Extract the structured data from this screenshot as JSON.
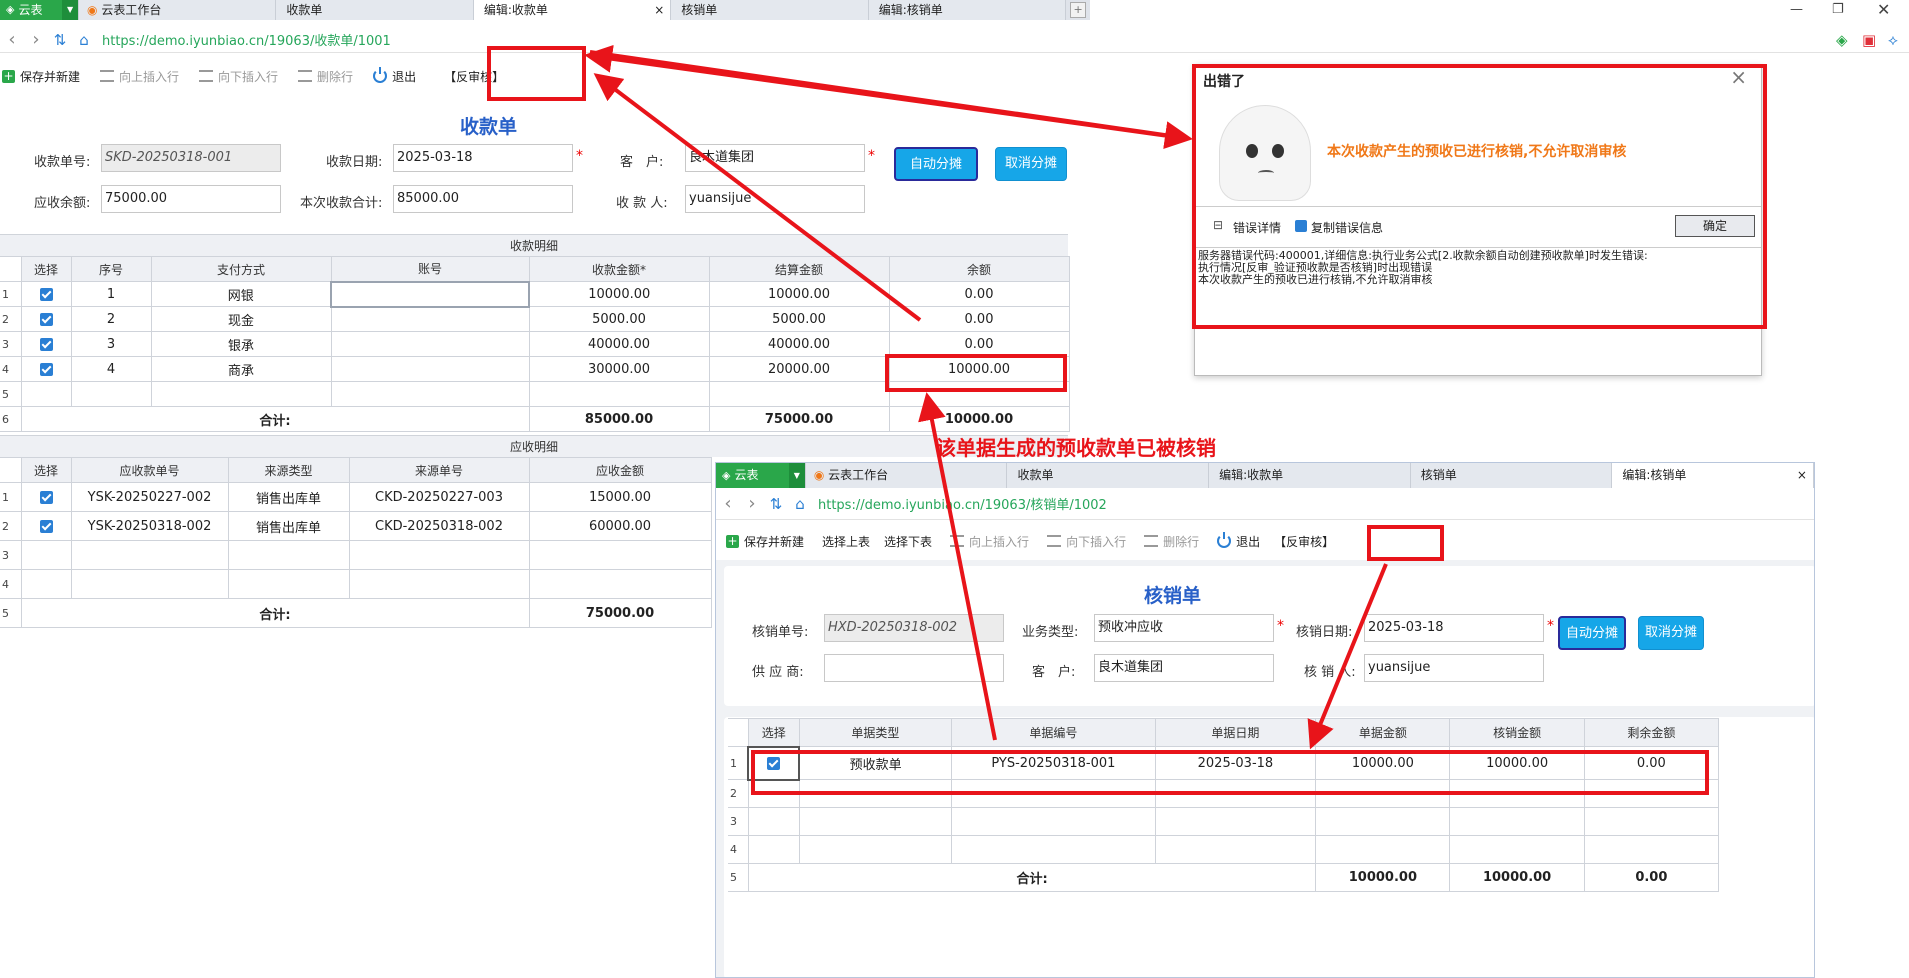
{
  "main_window": {
    "brand": "云表",
    "tabs": [
      {
        "label": "云表工作台"
      },
      {
        "label": "收款单"
      },
      {
        "label": "编辑:收款单",
        "active": true
      },
      {
        "label": "核销单"
      },
      {
        "label": "编辑:核销单"
      }
    ],
    "tab_close": "×",
    "url": "https://demo.iyunbiao.cn/19063/收款单/1001",
    "toolbar": {
      "save_new": "保存并新建",
      "insert_up": "向上插入行",
      "insert_down": "向下插入行",
      "delete_row": "删除行",
      "exit": "退出",
      "unaudit": "【反审核】"
    },
    "form": {
      "title": "收款单",
      "no_label": "收款单号:",
      "no_value": "SKD-20250318-001",
      "date_label": "收款日期:",
      "date_value": "2025-03-18",
      "customer_label": "客　户:",
      "customer_value": "良木道集团",
      "balance_label": "应收余额:",
      "balance_value": "75000.00",
      "total_label": "本次收款合计:",
      "total_value": "85000.00",
      "payee_label": "收 款 人:",
      "payee_value": "yuansijue",
      "auto_allocate": "自动分摊",
      "cancel_allocate": "取消分摊",
      "required_mark": "*"
    },
    "receipt_detail": {
      "caption": "收款明细",
      "columns": [
        "选择",
        "序号",
        "支付方式",
        "账号",
        "收款金额*",
        "结算金额",
        "余额"
      ],
      "rows": [
        {
          "rn": "1",
          "seq": "1",
          "method": "网银",
          "account": "",
          "amount": "10000.00",
          "settled": "10000.00",
          "balance": "0.00"
        },
        {
          "rn": "2",
          "seq": "2",
          "method": "现金",
          "account": "",
          "amount": "5000.00",
          "settled": "5000.00",
          "balance": "0.00"
        },
        {
          "rn": "3",
          "seq": "3",
          "method": "银承",
          "account": "",
          "amount": "40000.00",
          "settled": "40000.00",
          "balance": "0.00"
        },
        {
          "rn": "4",
          "seq": "4",
          "method": "商承",
          "account": "",
          "amount": "30000.00",
          "settled": "20000.00",
          "balance": "10000.00"
        }
      ],
      "empty_rn": "5",
      "total_rn": "6",
      "total_label": "合计:",
      "total_amount": "85000.00",
      "total_settled": "75000.00",
      "total_balance": "10000.00"
    },
    "receivable_detail": {
      "caption": "应收明细",
      "columns": [
        "选择",
        "应收款单号",
        "来源类型",
        "来源单号",
        "应收金额"
      ],
      "rows": [
        {
          "rn": "1",
          "no": "YSK-20250227-002",
          "type": "销售出库单",
          "src": "CKD-20250227-003",
          "amount": "15000.00"
        },
        {
          "rn": "2",
          "no": "YSK-20250318-002",
          "type": "销售出库单",
          "src": "CKD-20250318-002",
          "amount": "60000.00"
        }
      ],
      "empty_rns": [
        "3",
        "4"
      ],
      "total_rn": "5",
      "total_label": "合计:",
      "total_amount": "75000.00"
    }
  },
  "error_dialog": {
    "title": "出错了",
    "close": "×",
    "message": "本次收款产生的预收已进行核销,不允许取消审核",
    "details_toggle": "⊟",
    "details_label": "错误详情",
    "copy_label": "复制错误信息",
    "ok_button": "确定",
    "detail_lines": [
      "服务器错误代码:400001,详细信息:执行业务公式[2.收款余额自动创建预收款单]时发生错误:",
      "执行情况[反审_验证预收款是否核销]时出现错误",
      "本次收款产生的预收已进行核销,不允许取消审核"
    ]
  },
  "annotation": {
    "text": "该单据生成的预收款单已被核销"
  },
  "second_window": {
    "brand": "云表",
    "tabs": [
      {
        "label": "云表工作台"
      },
      {
        "label": "收款单"
      },
      {
        "label": "编辑:收款单"
      },
      {
        "label": "核销单"
      },
      {
        "label": "编辑:核销单",
        "active": true
      }
    ],
    "tab_close": "×",
    "url": "https://demo.iyunbiao.cn/19063/核销单/1002",
    "toolbar": {
      "save_new": "保存并新建",
      "select_up": "选择上表",
      "select_down": "选择下表",
      "insert_up": "向上插入行",
      "insert_down": "向下插入行",
      "delete_row": "删除行",
      "exit": "退出",
      "unaudit": "【反审核】"
    },
    "form": {
      "title": "核销单",
      "no_label": "核销单号:",
      "no_value": "HXD-20250318-002",
      "biz_label": "业务类型:",
      "biz_value": "预收冲应收",
      "date_label": "核销日期:",
      "date_value": "2025-03-18",
      "supplier_label": "供 应 商:",
      "supplier_value": "",
      "customer_label": "客　户:",
      "customer_value": "良木道集团",
      "verifier_label": "核 销 人:",
      "verifier_value": "yuansijue",
      "auto_allocate": "自动分摊",
      "cancel_allocate": "取消分摊",
      "required_mark": "*"
    },
    "detail": {
      "columns": [
        "选择",
        "单据类型",
        "单据编号",
        "单据日期",
        "单据金额",
        "核销金额",
        "剩余金额"
      ],
      "rows": [
        {
          "rn": "1",
          "type": "预收款单",
          "no": "PYS-20250318-001",
          "date": "2025-03-18",
          "amount": "10000.00",
          "verified": "10000.00",
          "remain": "0.00"
        }
      ],
      "empty_rns": [
        "2",
        "3",
        "4"
      ],
      "total_rn": "5",
      "total_label": "合计:",
      "total_amount": "10000.00",
      "total_verified": "10000.00",
      "total_remain": "0.00"
    }
  },
  "colors": {
    "brand_green": "#2aa74a",
    "accent_blue": "#16a6e8",
    "title_blue": "#2860c8",
    "annotation_red": "#e8141a",
    "error_orange": "#f07818"
  }
}
